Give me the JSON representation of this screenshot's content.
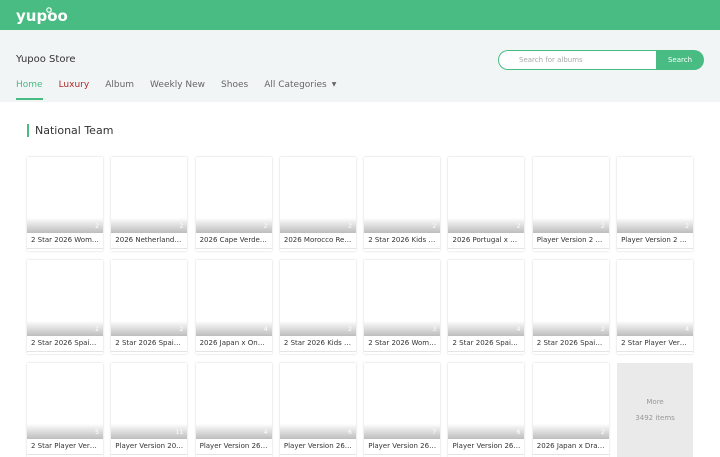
{
  "brand": {
    "logo_text": "yupoo",
    "accent": "#48bc83"
  },
  "store": {
    "name": "Yupoo Store"
  },
  "search": {
    "placeholder": "Search for albums",
    "button": "Search"
  },
  "nav": {
    "home": "Home",
    "luxury": "Luxury",
    "album": "Album",
    "weekly": "Weekly New",
    "shoes": "Shoes",
    "categories": "All Categories",
    "caret": "▼"
  },
  "section": {
    "title": "National Team"
  },
  "albums": [
    {
      "title": "2 Star 2026 Wom…",
      "count": "2"
    },
    {
      "title": "2026 Netherland…",
      "count": "2"
    },
    {
      "title": "2026 Cape Verde…",
      "count": "2"
    },
    {
      "title": "2026 Morocco Re…",
      "count": "2"
    },
    {
      "title": "2 Star 2026 Kids …",
      "count": "2"
    },
    {
      "title": "2026 Portugal x …",
      "count": "2"
    },
    {
      "title": "Player Version 2 …",
      "count": "2"
    },
    {
      "title": "Player Version 2 …",
      "count": "2"
    },
    {
      "title": "2 Star 2026 Spai…",
      "count": "2"
    },
    {
      "title": "2 Star 2026 Spai…",
      "count": "2"
    },
    {
      "title": "2026 Japan x On…",
      "count": "4"
    },
    {
      "title": "2 Star 2026 Kids …",
      "count": "2"
    },
    {
      "title": "2 Star 2026 Wom…",
      "count": "3"
    },
    {
      "title": "2 Star 2026 Spai…",
      "count": "4"
    },
    {
      "title": "2 Star 2026 Spai…",
      "count": "2"
    },
    {
      "title": "2 Star Player Ver…",
      "count": "4"
    },
    {
      "title": "2 Star Player Ver…",
      "count": "5"
    },
    {
      "title": "Player Version 20…",
      "count": "11"
    },
    {
      "title": "Player Version 26…",
      "count": "4"
    },
    {
      "title": "Player Version 26…",
      "count": "6"
    },
    {
      "title": "Player Version 26…",
      "count": "7"
    },
    {
      "title": "Player Version 26…",
      "count": "6"
    },
    {
      "title": "2026 Japan x Dra…",
      "count": "2"
    }
  ],
  "more": {
    "label": "More",
    "items": "3492 items"
  }
}
